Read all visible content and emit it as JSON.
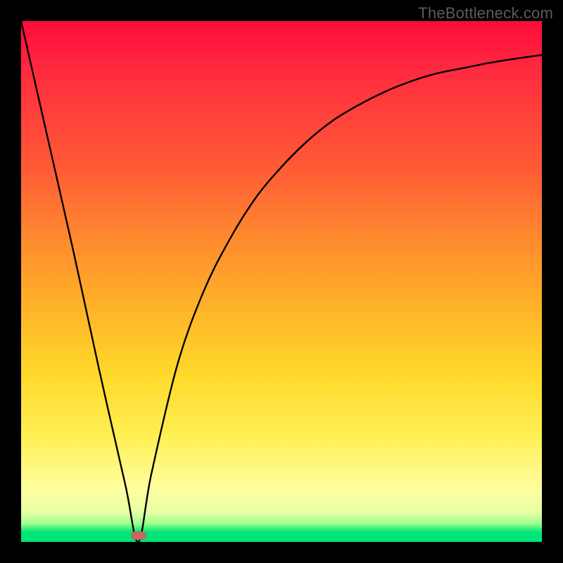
{
  "watermark": "TheBottleneck.com",
  "marker": {
    "x_pct": 22.5,
    "y_pct": 98.8,
    "color": "#c76766"
  },
  "chart_data": {
    "type": "line",
    "title": "",
    "xlabel": "",
    "ylabel": "",
    "xlim": [
      0,
      100
    ],
    "ylim": [
      0,
      100
    ],
    "grid": false,
    "series": [
      {
        "name": "bottleneck-curve",
        "x": [
          0,
          5,
          10,
          15,
          20,
          22.5,
          25,
          30,
          35,
          40,
          45,
          50,
          55,
          60,
          65,
          70,
          75,
          80,
          85,
          90,
          95,
          100
        ],
        "y": [
          100,
          78,
          56,
          33,
          11,
          0,
          13,
          34,
          48,
          58,
          66,
          72,
          77,
          81,
          84,
          86.5,
          88.5,
          90,
          91,
          92,
          92.8,
          93.5
        ]
      }
    ],
    "annotations": [
      {
        "type": "marker",
        "x": 22.5,
        "y": 0,
        "shape": "pill",
        "color": "#c76766"
      }
    ],
    "background_gradient": {
      "direction": "vertical",
      "stops": [
        {
          "pos": 0.0,
          "color": "#ff0b3a"
        },
        {
          "pos": 0.5,
          "color": "#ff9a2c"
        },
        {
          "pos": 0.8,
          "color": "#fff056"
        },
        {
          "pos": 0.95,
          "color": "#e3ffa3"
        },
        {
          "pos": 1.0,
          "color": "#00e676"
        }
      ]
    }
  }
}
